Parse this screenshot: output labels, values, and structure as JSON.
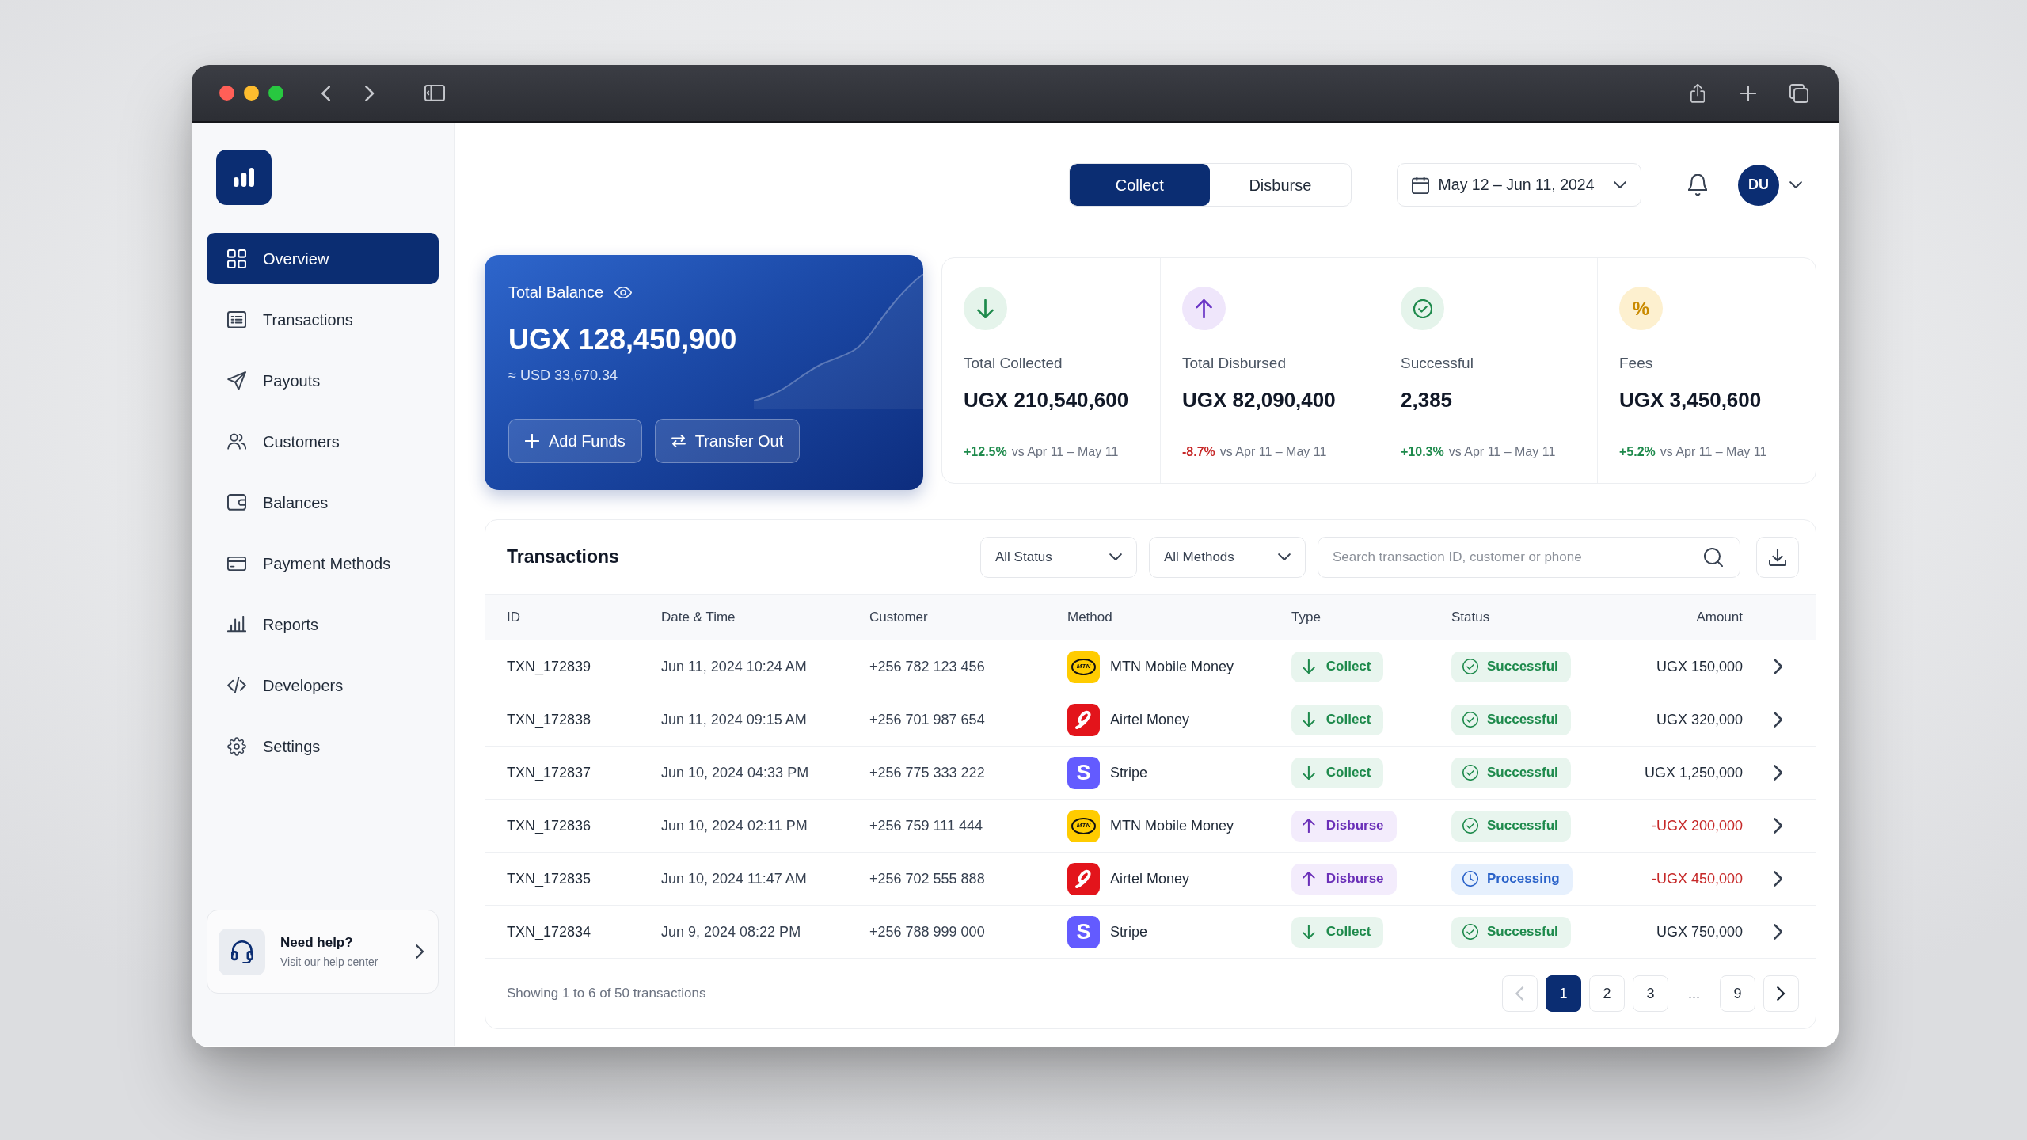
{
  "sidebar": {
    "items": [
      {
        "label": "Overview",
        "selected": true
      },
      {
        "label": "Transactions",
        "selected": false
      },
      {
        "label": "Payouts",
        "selected": false
      },
      {
        "label": "Customers",
        "selected": false
      },
      {
        "label": "Balances",
        "selected": false
      },
      {
        "label": "Payment Methods",
        "selected": false
      },
      {
        "label": "Reports",
        "selected": false
      },
      {
        "label": "Developers",
        "selected": false
      },
      {
        "label": "Settings",
        "selected": false
      }
    ],
    "help": {
      "title": "Need help?",
      "subtitle": "Visit our help center"
    }
  },
  "header": {
    "modes": [
      {
        "label": "Collect",
        "selected": true
      },
      {
        "label": "Disburse",
        "selected": false
      }
    ],
    "date_range": "May 12 – Jun 11, 2024",
    "user_initials": "DU"
  },
  "balance": {
    "label": "Total Balance",
    "amount": "UGX 128,450,900",
    "converted": "≈ USD 33,670.34",
    "actions": [
      "Add Funds",
      "Transfer Out"
    ]
  },
  "stats": [
    {
      "kind": "collected",
      "label": "Total Collected",
      "value": "UGX 210,540,600",
      "change": "+12.5%",
      "negative": false,
      "period": "vs Apr 11 – May 11"
    },
    {
      "kind": "disbursed",
      "label": "Total Disbursed",
      "value": "UGX 82,090,400",
      "change": "-8.7%",
      "negative": true,
      "period": "vs Apr 11 – May 11"
    },
    {
      "kind": "successful",
      "label": "Successful",
      "value": "2,385",
      "change": "+10.3%",
      "negative": false,
      "period": "vs Apr 11 – May 11"
    },
    {
      "kind": "fees",
      "icon_text": "%",
      "label": "Fees",
      "value": "UGX 3,450,600",
      "change": "+5.2%",
      "negative": false,
      "period": "vs Apr 11 – May 11"
    }
  ],
  "transactions": {
    "title": "Transactions",
    "filters": [
      {
        "label": "All Status"
      },
      {
        "label": "All Methods"
      }
    ],
    "search": {
      "placeholder": "Search transaction ID, customer or phone"
    },
    "columns": [
      "ID",
      "Date & Time",
      "Customer",
      "Method",
      "Type",
      "Status",
      "Amount"
    ],
    "rows": [
      {
        "id": "TXN_172839",
        "date_time": "Jun 11, 2024 10:24 AM",
        "customer": "+256 782 123 456",
        "method": {
          "name": "MTN Mobile Money",
          "kind": "ring",
          "logo_text": "MTN"
        },
        "type": {
          "label": "Collect",
          "kind": "collect"
        },
        "status": {
          "label": "Successful",
          "kind": "success"
        },
        "amount": "UGX 150,000",
        "negative": false
      },
      {
        "id": "TXN_172838",
        "date_time": "Jun 11, 2024 09:15 AM",
        "customer": "+256 701 987 654",
        "method": {
          "name": "Airtel Money",
          "kind": "swirl"
        },
        "type": {
          "label": "Collect",
          "kind": "collect"
        },
        "status": {
          "label": "Successful",
          "kind": "success"
        },
        "amount": "UGX 320,000",
        "negative": false
      },
      {
        "id": "TXN_172837",
        "date_time": "Jun 10, 2024 04:33 PM",
        "customer": "+256 775 333 222",
        "method": {
          "name": "Stripe",
          "kind": "letter",
          "logo_text": "S"
        },
        "type": {
          "label": "Collect",
          "kind": "collect"
        },
        "status": {
          "label": "Successful",
          "kind": "success"
        },
        "amount": "UGX 1,250,000",
        "negative": false
      },
      {
        "id": "TXN_172836",
        "date_time": "Jun 10, 2024 02:11 PM",
        "customer": "+256 759 111 444",
        "method": {
          "name": "MTN Mobile Money",
          "kind": "ring",
          "logo_text": "MTN"
        },
        "type": {
          "label": "Disburse",
          "kind": "disburse"
        },
        "status": {
          "label": "Successful",
          "kind": "success"
        },
        "amount": "-UGX 200,000",
        "negative": true
      },
      {
        "id": "TXN_172835",
        "date_time": "Jun 10, 2024 11:47 AM",
        "customer": "+256 702 555 888",
        "method": {
          "name": "Airtel Money",
          "kind": "swirl"
        },
        "type": {
          "label": "Disburse",
          "kind": "disburse"
        },
        "status": {
          "label": "Processing",
          "kind": "processing"
        },
        "amount": "-UGX 450,000",
        "negative": true
      },
      {
        "id": "TXN_172834",
        "date_time": "Jun 9, 2024 08:22 PM",
        "customer": "+256 788 999 000",
        "method": {
          "name": "Stripe",
          "kind": "letter",
          "logo_text": "S"
        },
        "type": {
          "label": "Collect",
          "kind": "collect"
        },
        "status": {
          "label": "Successful",
          "kind": "success"
        },
        "amount": "UGX 750,000",
        "negative": false
      }
    ],
    "summary": "Showing 1 to 6 of 50 transactions",
    "pagination": {
      "previous": {
        "disabled": true
      },
      "pages": [
        {
          "kind": "page",
          "label": "1",
          "selected": true
        },
        {
          "kind": "page",
          "label": "2",
          "selected": false
        },
        {
          "kind": "page",
          "label": "3",
          "selected": false
        },
        {
          "kind": "gap",
          "label": "..."
        },
        {
          "kind": "page",
          "label": "9",
          "selected": false
        }
      ],
      "next": {
        "disabled": false
      }
    }
  }
}
